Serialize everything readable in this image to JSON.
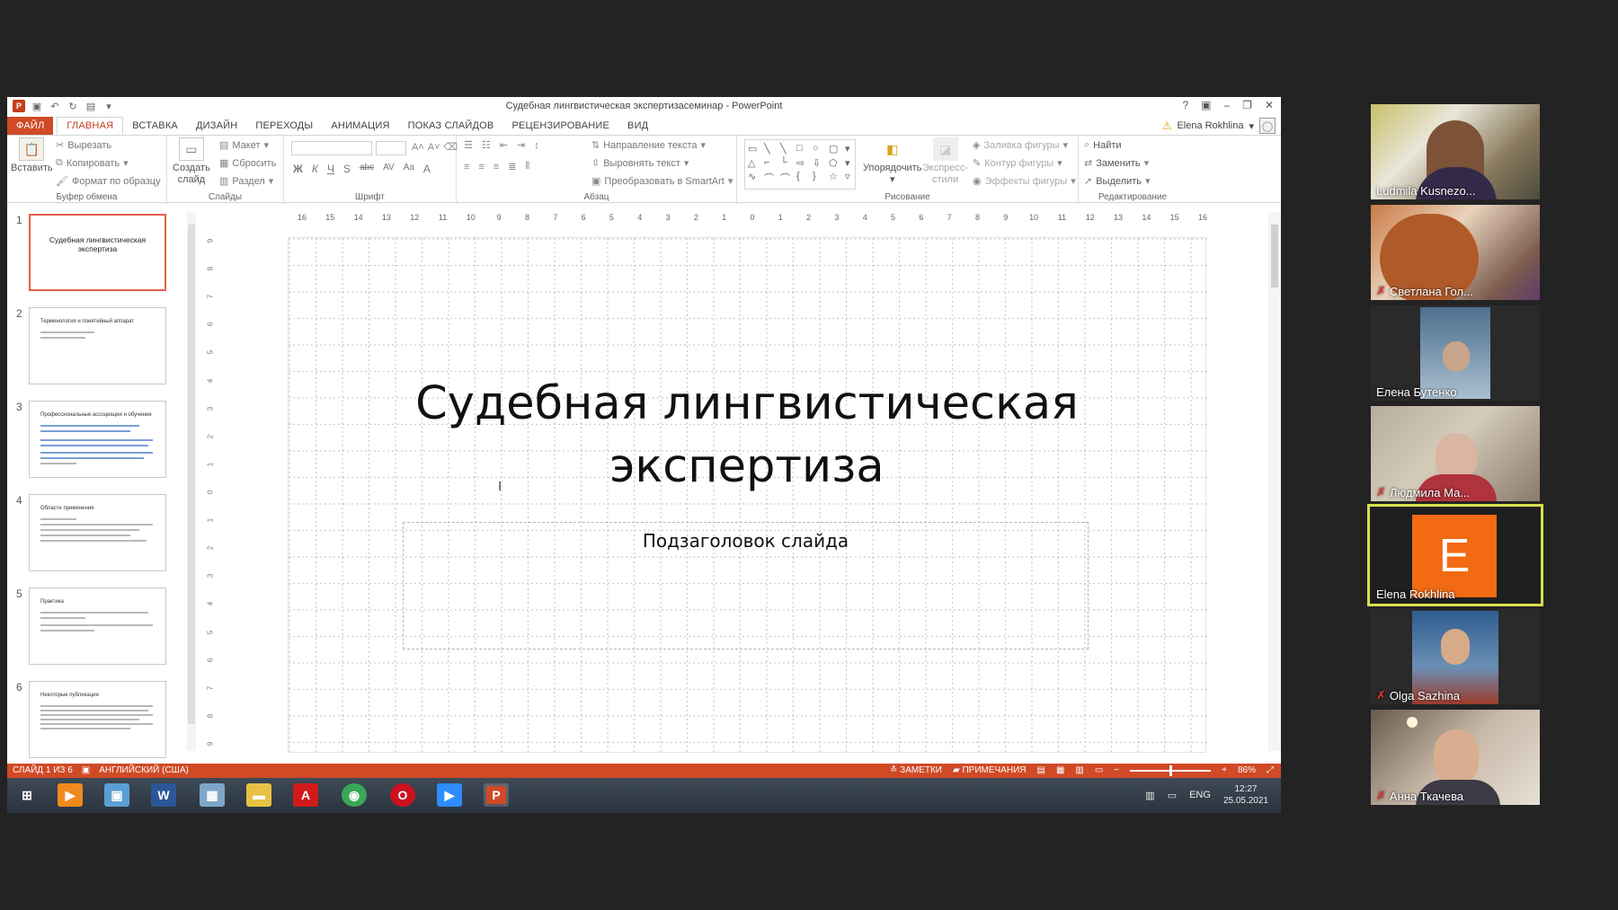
{
  "titlebar": {
    "title": "Судебная лингвистическая экспертизасеминар - PowerPoint",
    "controls": [
      "?",
      "▣",
      "–",
      "❐",
      "✕"
    ]
  },
  "tabs": [
    "ФАЙЛ",
    "ГЛАВНАЯ",
    "ВСТАВКА",
    "ДИЗАЙН",
    "ПЕРЕХОДЫ",
    "АНИМАЦИЯ",
    "ПОКАЗ СЛАЙДОВ",
    "РЕЦЕНЗИРОВАНИЕ",
    "ВИД"
  ],
  "active_tab": "ГЛАВНАЯ",
  "account": {
    "name": "Elena Rokhlina"
  },
  "ribbon": {
    "clipboard": {
      "paste": "Вставить",
      "cut": "Вырезать",
      "copy": "Копировать",
      "format": "Формат по образцу",
      "label": "Буфер обмена"
    },
    "slides": {
      "new_slide_1": "Создать",
      "new_slide_2": "слайд",
      "layout": "Макет",
      "reset": "Сбросить",
      "section": "Раздел",
      "label": "Слайды"
    },
    "font": {
      "label": "Шрифт",
      "buttons": [
        "Ж",
        "К",
        "Ч",
        "S",
        "abc",
        "AV",
        "Aa",
        "A"
      ]
    },
    "paragraph": {
      "text_direction": "Направление текста",
      "align_text": "Выровнять текст",
      "smartart": "Преобразовать в SmartArt",
      "label": "Абзац"
    },
    "drawing": {
      "arrange": "Упорядочить",
      "quick_styles_1": "Экспресс-",
      "quick_styles_2": "стили",
      "fill": "Заливка фигуры",
      "outline": "Контур фигуры",
      "effects": "Эффекты фигуры",
      "label": "Рисование"
    },
    "editing": {
      "find": "Найти",
      "replace": "Заменить",
      "select": "Выделить",
      "label": "Редактирование"
    }
  },
  "thumbnails": [
    {
      "num": "1",
      "title": "Судебная лингвистическая экспертиза"
    },
    {
      "num": "2",
      "title": "Терминология и понятийный аппарат"
    },
    {
      "num": "3",
      "title": "Профессиональные ассоциации и обучение"
    },
    {
      "num": "4",
      "title": "Области применения"
    },
    {
      "num": "5",
      "title": "Практика"
    },
    {
      "num": "6",
      "title": "Некоторые публикации"
    }
  ],
  "ruler_h": [
    "16",
    "15",
    "14",
    "13",
    "12",
    "11",
    "10",
    "9",
    "8",
    "7",
    "6",
    "5",
    "4",
    "3",
    "2",
    "1",
    "0",
    "1",
    "2",
    "3",
    "4",
    "5",
    "6",
    "7",
    "8",
    "9",
    "10",
    "11",
    "12",
    "13",
    "14",
    "15",
    "16"
  ],
  "ruler_v": [
    "9",
    "8",
    "7",
    "6",
    "5",
    "4",
    "3",
    "2",
    "1",
    "0",
    "1",
    "2",
    "3",
    "4",
    "5",
    "6",
    "7",
    "8",
    "9"
  ],
  "slide": {
    "title_line1": "Судебная лингвистическая",
    "title_line2": "экспертиза",
    "subtitle": "Подзаголовок слайда"
  },
  "statusbar": {
    "slide_info": "СЛАЙД 1 ИЗ 6",
    "language": "АНГЛИЙСКИЙ (США)",
    "notes": "ЗАМЕТКИ",
    "comments": "ПРИМЕЧАНИЯ",
    "zoom": "86%"
  },
  "taskbar": {
    "lang": "ENG",
    "time": "12:27",
    "date": "25.05.2021"
  },
  "participants": [
    {
      "name": "Ludmila Kusnezo...",
      "muted": false
    },
    {
      "name": "Светлана Гол...",
      "muted": true
    },
    {
      "name": "Елена Бутенко",
      "muted": false
    },
    {
      "name": "Людмила Ма...",
      "muted": true
    },
    {
      "name": "Elena Rokhlina",
      "muted": false,
      "initial": "E",
      "active_speaker": true
    },
    {
      "name": "Olga Sazhina",
      "muted": true
    },
    {
      "name": "Анна Ткачева",
      "muted": true
    }
  ],
  "colors": {
    "ppt_accent": "#d04a26",
    "speaker_outline": "#d8e04a",
    "avatar_orange": "#f26a14"
  }
}
